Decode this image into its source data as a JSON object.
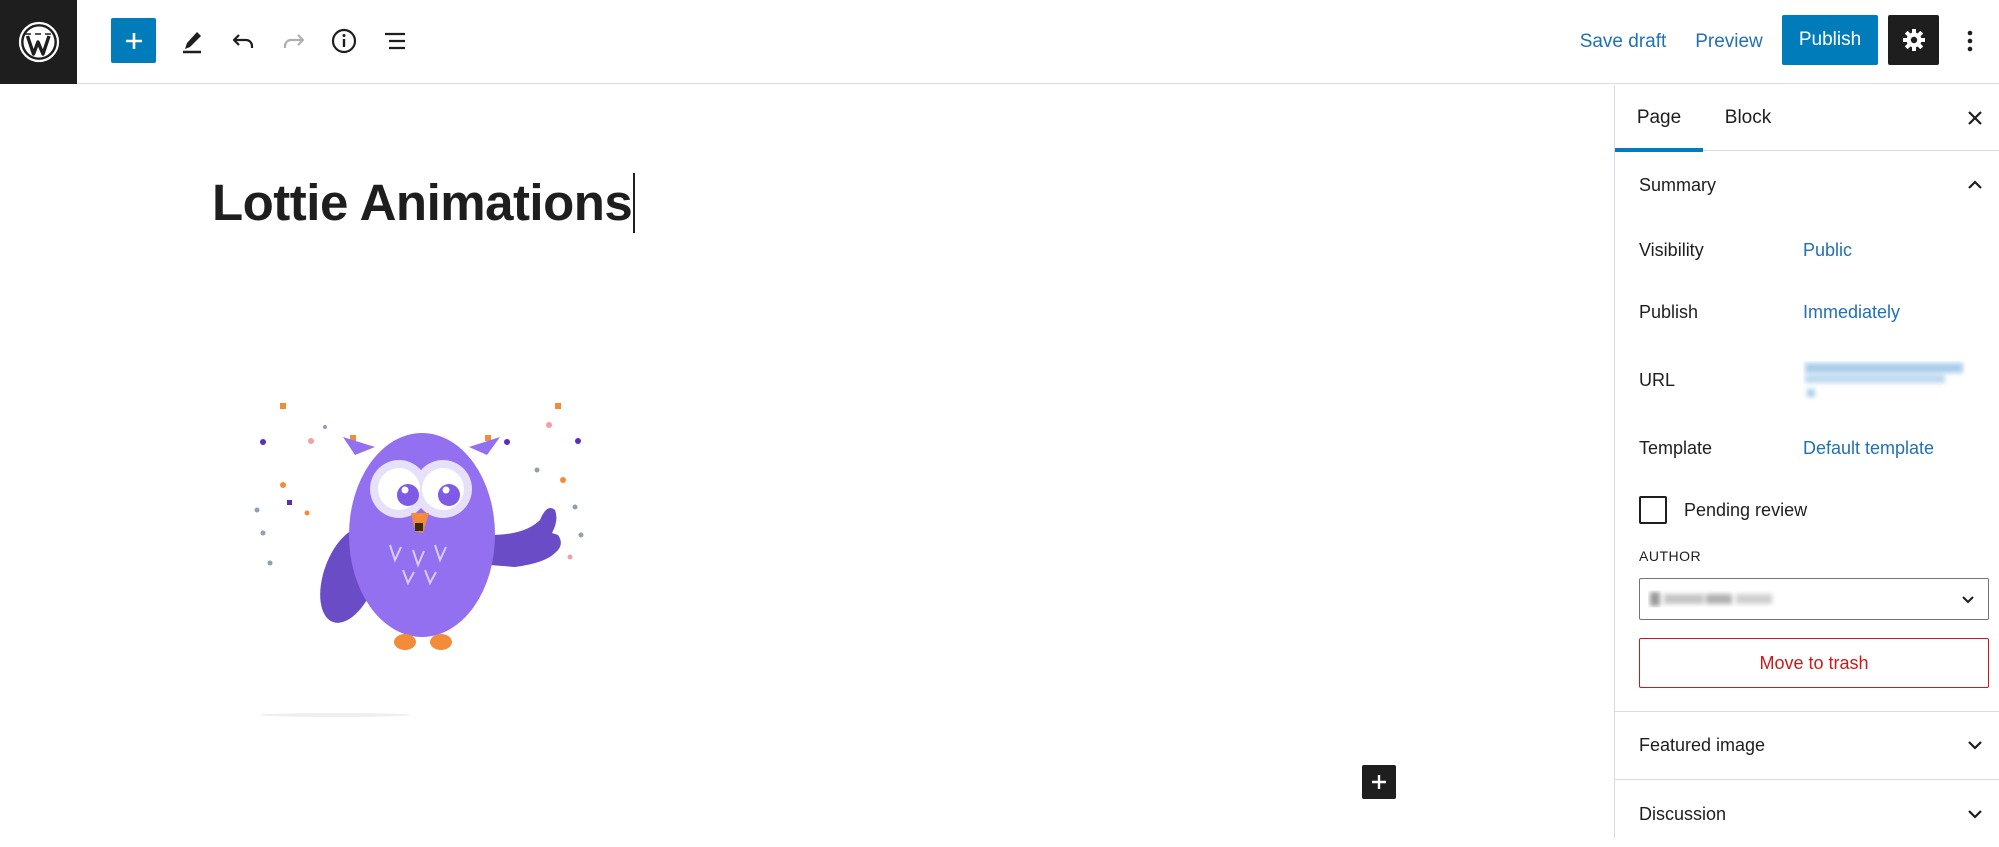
{
  "toolbar": {
    "save_draft": "Save draft",
    "preview": "Preview",
    "publish": "Publish",
    "icons": {
      "logo": "wordpress-logo-icon",
      "inserter": "plus-icon",
      "tools": "pencil-icon",
      "undo": "undo-icon",
      "redo": "redo-icon",
      "details": "info-icon",
      "list_view": "list-view-icon",
      "settings": "gear-icon",
      "more": "more-vertical-icon"
    },
    "accent_color": "#007cba"
  },
  "editor": {
    "title": "Lottie Animations",
    "image_icon": "lottie-owl-animation"
  },
  "sidebar": {
    "tabs": [
      {
        "label": "Page",
        "active": true
      },
      {
        "label": "Block",
        "active": false
      }
    ],
    "summary": {
      "title": "Summary",
      "expanded": true,
      "visibility": {
        "label": "Visibility",
        "value": "Public"
      },
      "publish": {
        "label": "Publish",
        "value": "Immediately"
      },
      "url": {
        "label": "URL"
      },
      "template": {
        "label": "Template",
        "value": "Default template"
      },
      "pending_review": {
        "label": "Pending review",
        "checked": false
      },
      "author": {
        "label": "AUTHOR"
      },
      "trash": "Move to trash"
    },
    "panels": [
      {
        "title": "Featured image",
        "expanded": false
      },
      {
        "title": "Discussion",
        "expanded": false
      }
    ],
    "danger_color": "#cc1818",
    "link_color": "#2271b1"
  }
}
